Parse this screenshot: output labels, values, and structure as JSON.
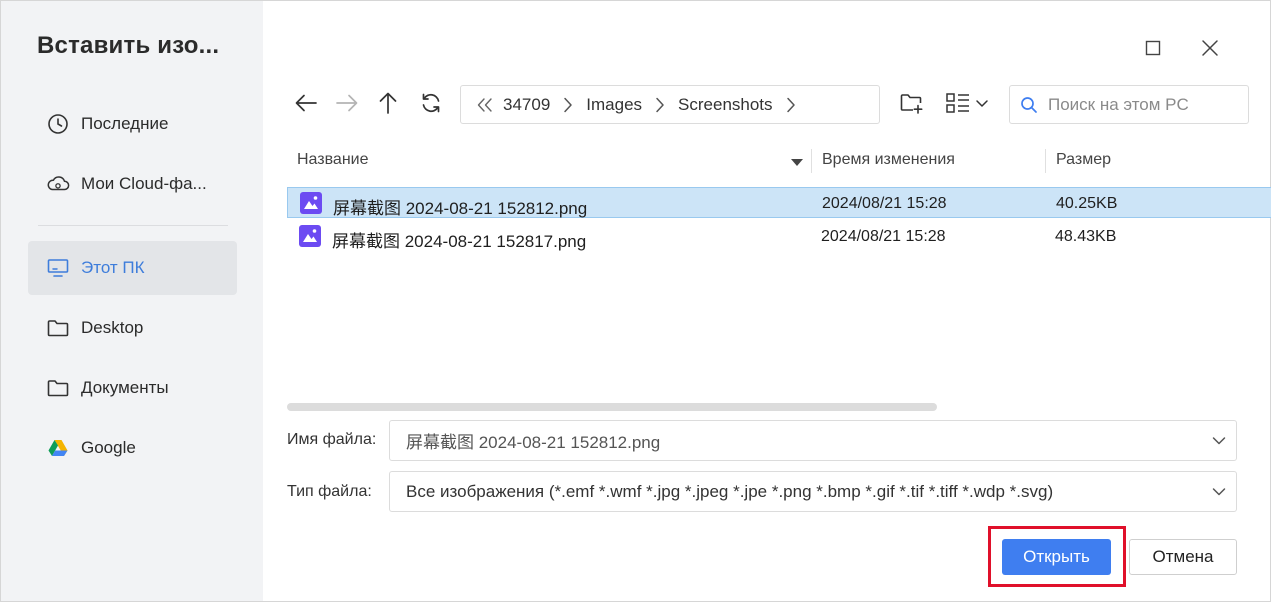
{
  "sidebar": {
    "title": "Вставить изо...",
    "items": [
      {
        "label": "Последние",
        "icon": "clock-icon"
      },
      {
        "label": "Мои Cloud-фа...",
        "icon": "cloud-icon"
      },
      {
        "label": "Этот ПК",
        "icon": "monitor-icon",
        "active": true
      },
      {
        "label": "Desktop",
        "icon": "folder-icon"
      },
      {
        "label": "Документы",
        "icon": "folder-icon"
      },
      {
        "label": "Google",
        "icon": "google-drive-icon"
      }
    ]
  },
  "window": {
    "maximize_icon": "maximize-icon",
    "close_icon": "close-icon"
  },
  "toolbar": {
    "back_icon": "back-arrow-icon",
    "forward_icon": "forward-arrow-icon",
    "up_icon": "up-arrow-icon",
    "refresh_icon": "refresh-icon",
    "new_folder_icon": "new-folder-icon",
    "view_icon": "view-mode-icon"
  },
  "breadcrumb": {
    "overflow_icon": "double-chevron-left-icon",
    "items": [
      "34709",
      "Images",
      "Screenshots"
    ]
  },
  "search": {
    "placeholder": "Поиск на этом PC"
  },
  "columns": {
    "name": "Название",
    "modified": "Время изменения",
    "size": "Размер"
  },
  "files": [
    {
      "name": "屏幕截图 2024-08-21 152812.png",
      "modified": "2024/08/21 15:28",
      "size": "40.25KB",
      "selected": true
    },
    {
      "name": "屏幕截图 2024-08-21 152817.png",
      "modified": "2024/08/21 15:28",
      "size": "48.43KB",
      "selected": false
    }
  ],
  "form": {
    "filename_label": "Имя файла:",
    "filename_value": "屏幕截图 2024-08-21 152812.png",
    "filetype_label": "Тип файла:",
    "filetype_value": "Все изображения (*.emf *.wmf *.jpg *.jpeg *.jpe *.png *.bmp *.gif *.tif *.tiff *.wdp *.svg)"
  },
  "buttons": {
    "open": "Открыть",
    "cancel": "Отмена"
  },
  "colors": {
    "accent": "#3f7ef0",
    "active_nav_text": "#3e7ddb",
    "selection": "#cce4f7",
    "highlight_box": "#e0102a",
    "image_icon": "#6c4bf2"
  }
}
